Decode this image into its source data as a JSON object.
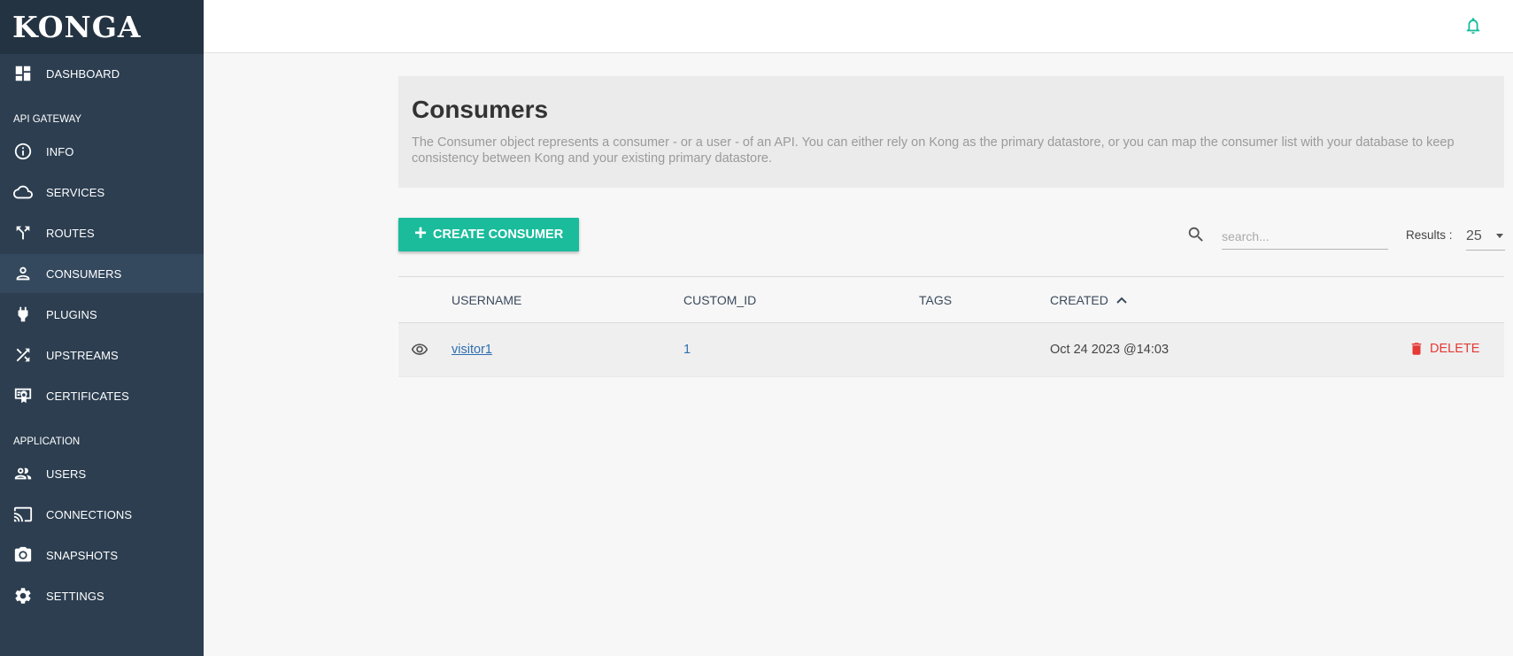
{
  "app": {
    "logo": "KONGA"
  },
  "sidebar": {
    "sections": {
      "api_gateway": "API GATEWAY",
      "application": "APPLICATION"
    },
    "items": [
      {
        "label": "DASHBOARD",
        "icon": "dashboard-icon"
      },
      {
        "label": "INFO",
        "icon": "info-icon"
      },
      {
        "label": "SERVICES",
        "icon": "cloud-icon"
      },
      {
        "label": "ROUTES",
        "icon": "routes-icon"
      },
      {
        "label": "CONSUMERS",
        "icon": "person-icon",
        "active": true
      },
      {
        "label": "PLUGINS",
        "icon": "plug-icon"
      },
      {
        "label": "UPSTREAMS",
        "icon": "shuffle-icon"
      },
      {
        "label": "CERTIFICATES",
        "icon": "certificate-icon"
      },
      {
        "label": "USERS",
        "icon": "users-icon"
      },
      {
        "label": "CONNECTIONS",
        "icon": "cast-icon"
      },
      {
        "label": "SNAPSHOTS",
        "icon": "camera-icon"
      },
      {
        "label": "SETTINGS",
        "icon": "gear-icon"
      }
    ]
  },
  "topbar": {
    "notification_icon": "bell-icon"
  },
  "header": {
    "title": "Consumers",
    "description": "The Consumer object represents a consumer - or a user - of an API. You can either rely on Kong as the primary datastore, or you can map the consumer list with your database to keep consistency between Kong and your existing primary datastore."
  },
  "toolbar": {
    "create_label": "CREATE CONSUMER",
    "search_placeholder": "search...",
    "results_label": "Results :",
    "results_value": "25"
  },
  "table": {
    "columns": [
      "USERNAME",
      "CUSTOM_ID",
      "TAGS",
      "CREATED"
    ],
    "sort": {
      "column": "CREATED",
      "direction": "ascending"
    },
    "rows": [
      {
        "username": "visitor1",
        "custom_id": "1",
        "tags": "",
        "created": "Oct 24 2023 @14:03",
        "delete_label": "DELETE"
      }
    ]
  },
  "colors": {
    "accent": "#1abc9c",
    "sidebar": "#2c3e50",
    "danger": "#e53935",
    "link": "#2f6fb0"
  }
}
